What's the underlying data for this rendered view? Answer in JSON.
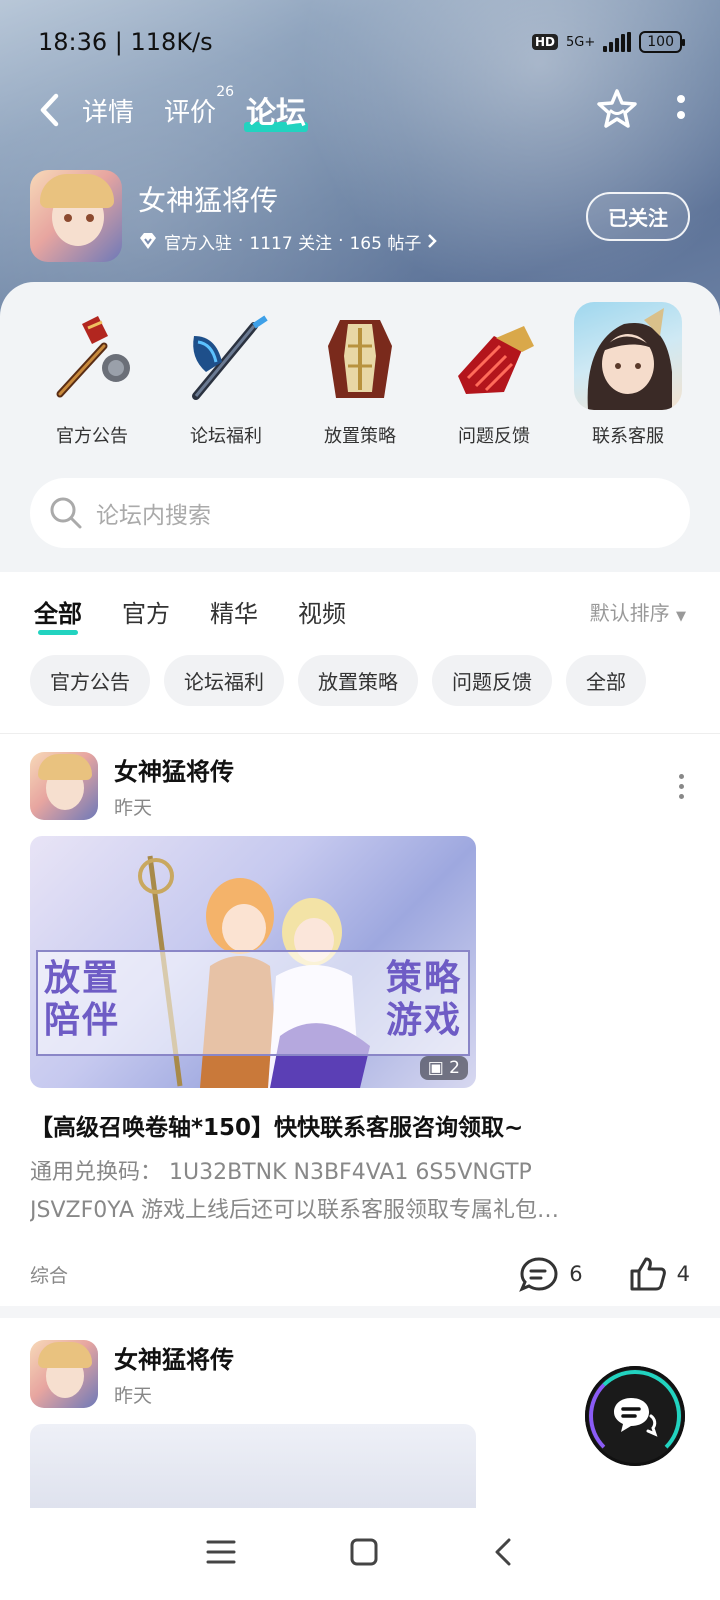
{
  "status_bar": {
    "time": "18:36 | 118K/s",
    "hd": "HD",
    "network": "5G+",
    "battery": "100"
  },
  "top_nav": {
    "tabs": [
      {
        "label": "详情"
      },
      {
        "label": "评价",
        "badge": "26"
      },
      {
        "label": "论坛"
      }
    ]
  },
  "game": {
    "name": "女神猛将传",
    "official": "官方入驻",
    "followers": "1117 关注",
    "posts": "165 帖子",
    "follow_label": "已关注"
  },
  "shortcuts": [
    {
      "label": "官方公告",
      "icon": "mace-icon"
    },
    {
      "label": "论坛福利",
      "icon": "axe-icon"
    },
    {
      "label": "放置策略",
      "icon": "armor-icon"
    },
    {
      "label": "问题反馈",
      "icon": "gauntlet-icon"
    },
    {
      "label": "联系客服",
      "icon": "character-portrait"
    }
  ],
  "search": {
    "placeholder": "论坛内搜索"
  },
  "filter_tabs": [
    "全部",
    "官方",
    "精华",
    "视频"
  ],
  "sort_label": "默认排序",
  "chips": [
    "官方公告",
    "论坛福利",
    "放置策略",
    "问题反馈",
    "全部"
  ],
  "posts": [
    {
      "author": "女神猛将传",
      "time": "昨天",
      "image_text": {
        "left_top": "放置",
        "left_bottom": "陪伴",
        "right_top": "策略",
        "right_bottom": "游戏"
      },
      "image_count": "2",
      "title": "【高级召唤卷轴*150】快快联系客服咨询领取~",
      "body_line1": "通用兑换码： 1U32BTNK N3BF4VA1 6S5VNGTP",
      "body_line2": "JSVZF0YA 游戏上线后还可以联系客服领取专属礼包…",
      "tag": "综合",
      "comments": "6",
      "likes": "4"
    },
    {
      "author": "女神猛将传",
      "time": "昨天"
    }
  ],
  "colors": {
    "accent": "#22d3c0"
  }
}
